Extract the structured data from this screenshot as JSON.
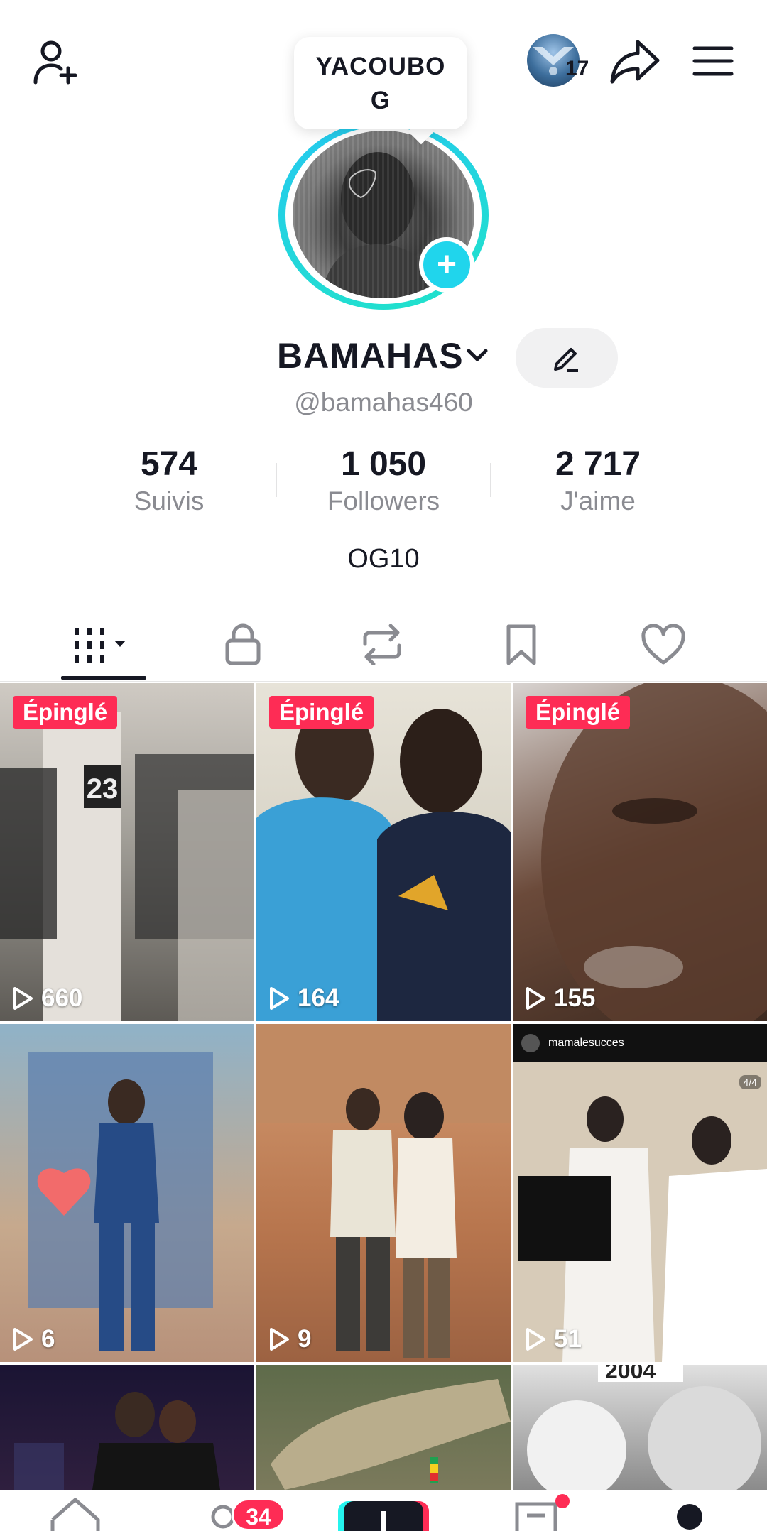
{
  "profile": {
    "tooltip_name": "YACOUBO G",
    "display_name": "BAMAHAS",
    "handle": "@bamahas460",
    "story_count": "17",
    "bio": "OG10"
  },
  "stats": [
    {
      "value": "574",
      "label": "Suivis"
    },
    {
      "value": "1 050",
      "label": "Followers"
    },
    {
      "value": "2 717",
      "label": "J'aime"
    }
  ],
  "tabs": [
    "videos-grid",
    "private",
    "reposts",
    "saved",
    "liked"
  ],
  "videos": [
    {
      "pinned": "Épinglé",
      "views": "660"
    },
    {
      "pinned": "Épinglé",
      "views": "164"
    },
    {
      "pinned": "Épinglé",
      "views": "155"
    },
    {
      "pinned": "",
      "views": "6"
    },
    {
      "pinned": "",
      "views": "9"
    },
    {
      "pinned": "",
      "views": "51",
      "caption": "mamalesucces",
      "counter": "4/4"
    },
    {
      "pinned": "",
      "views": ""
    },
    {
      "pinned": "",
      "views": ""
    },
    {
      "pinned": "",
      "views": "",
      "caption": "2004"
    }
  ],
  "nav": {
    "inbox_badge": "34"
  },
  "colors": {
    "accent": "#fe2c55",
    "ring": "#20d5ec"
  }
}
